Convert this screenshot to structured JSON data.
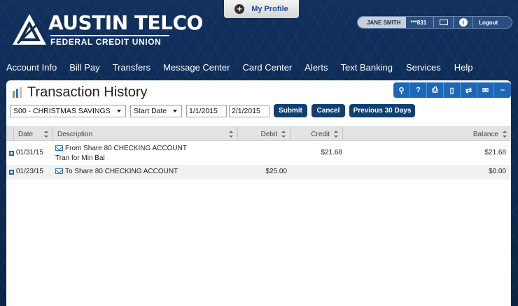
{
  "header": {
    "profile_label": "My Profile",
    "logo_title": "AUSTIN TELCO",
    "logo_subtitle": "FEDERAL CREDIT UNION",
    "user_name": "JANE SMITH",
    "account_mask": "***831",
    "logout_label": "Logout"
  },
  "nav": {
    "items": [
      {
        "label": "Account Info"
      },
      {
        "label": "Bill Pay"
      },
      {
        "label": "Transfers"
      },
      {
        "label": "Message Center"
      },
      {
        "label": "Card Center"
      },
      {
        "label": "Alerts"
      },
      {
        "label": "Text Banking"
      },
      {
        "label": "Services"
      },
      {
        "label": "Help"
      }
    ]
  },
  "page": {
    "title": "Transaction History",
    "toolbar_icons": [
      "search-icon",
      "help-icon",
      "print-icon",
      "mobile-icon",
      "shuffle-icon",
      "email-add-icon",
      "collapse-icon"
    ]
  },
  "filter": {
    "account": "S00 - CHRISTMAS SAVINGS",
    "date_mode": "Start Date",
    "start_date": "1/1/2015",
    "end_date": "2/1/2015",
    "submit_label": "Submit",
    "cancel_label": "Cancel",
    "prev_label": "Previous 30 Days"
  },
  "table": {
    "columns": [
      "Date",
      "Description",
      "Debit",
      "Credit",
      "Balance"
    ],
    "rows": [
      {
        "date": "01/31/15",
        "description": "From Share 80 CHECKING ACCOUNT",
        "memo": "Tran for Min Bal",
        "debit": "",
        "credit": "$21.68",
        "balance": "$21.68"
      },
      {
        "date": "01/23/15",
        "description": "To Share 80 CHECKING ACCOUNT",
        "memo": "",
        "debit": "$25.00",
        "credit": "",
        "balance": "$0.00"
      }
    ]
  },
  "colors": {
    "background": "#0f2c57",
    "accent": "#1d67b7",
    "button": "#0f3f73"
  }
}
